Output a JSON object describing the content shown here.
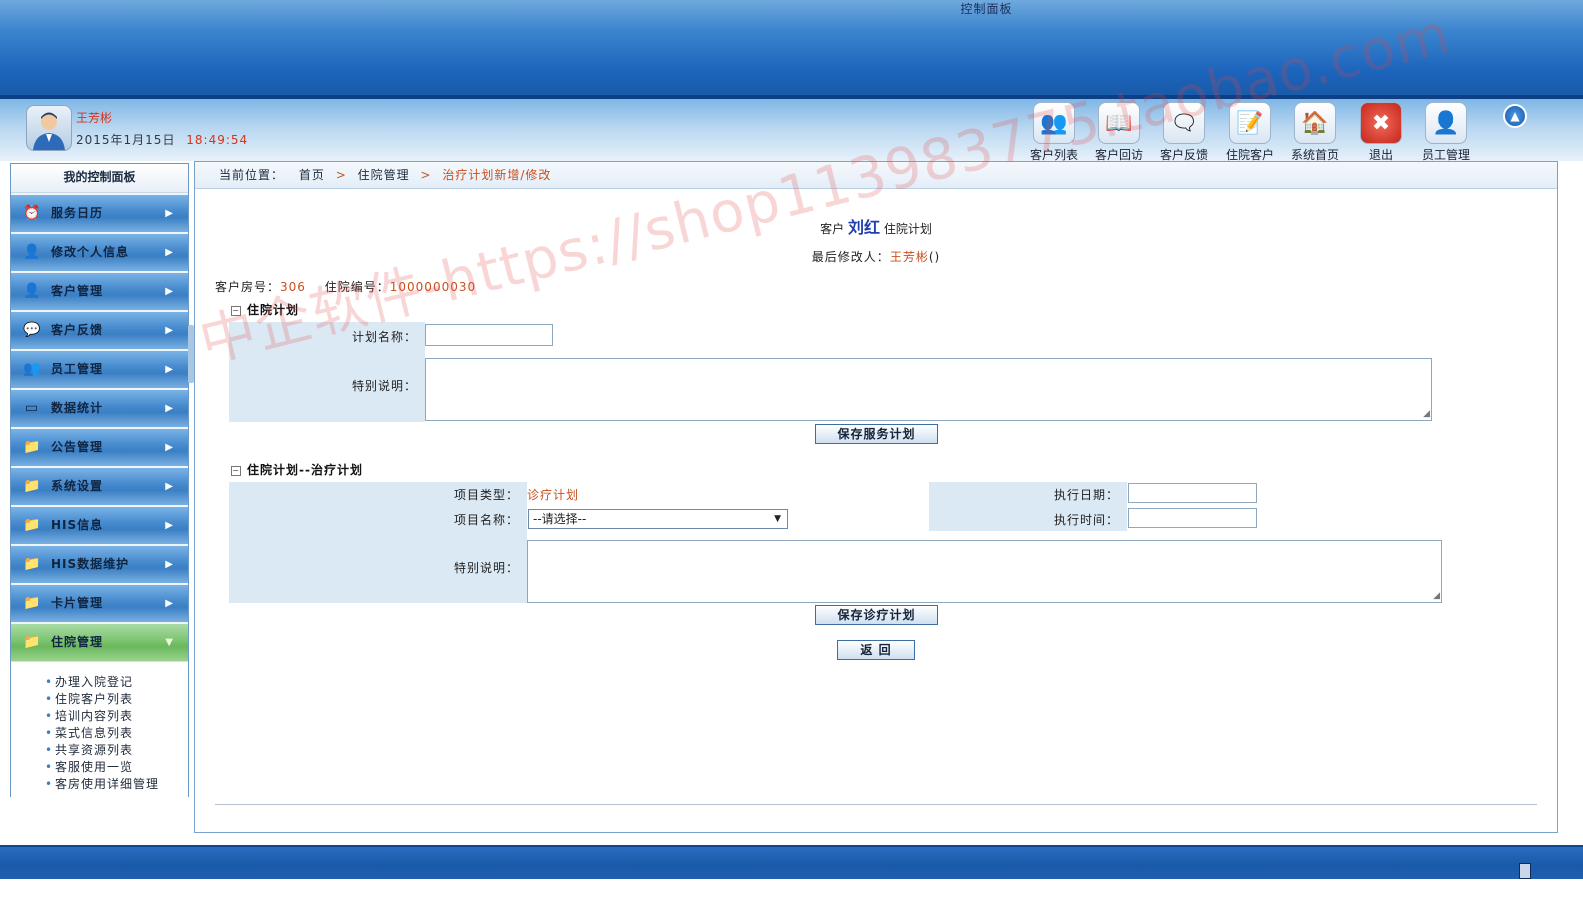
{
  "header": {
    "title": "控制面板"
  },
  "user": {
    "name": "王芳彬",
    "date": "2015年1月15日",
    "time": "18:49:54"
  },
  "toolbar": [
    {
      "label": "客户列表",
      "icon": "👥"
    },
    {
      "label": "客户回访",
      "icon": "📖"
    },
    {
      "label": "客户反馈",
      "icon": "🗨"
    },
    {
      "label": "住院客户",
      "icon": "📝"
    },
    {
      "label": "系统首页",
      "icon": "🏠"
    },
    {
      "label": "退出",
      "icon": "✖"
    },
    {
      "label": "员工管理",
      "icon": "👤"
    }
  ],
  "sidebar": {
    "title": "我的控制面板",
    "items": [
      {
        "label": "服务日历",
        "icon": "⏰"
      },
      {
        "label": "修改个人信息",
        "icon": "👤"
      },
      {
        "label": "客户管理",
        "icon": "👤"
      },
      {
        "label": "客户反馈",
        "icon": "💬"
      },
      {
        "label": "员工管理",
        "icon": "👥"
      },
      {
        "label": "数据统计",
        "icon": "▭"
      },
      {
        "label": "公告管理",
        "icon": "📁"
      },
      {
        "label": "系统设置",
        "icon": "📁"
      },
      {
        "label": "HIS信息",
        "icon": "📁"
      },
      {
        "label": "HIS数据维护",
        "icon": "📁"
      },
      {
        "label": "卡片管理",
        "icon": "📁"
      },
      {
        "label": "住院管理",
        "icon": "📁"
      }
    ],
    "submenu": [
      "办理入院登记",
      "住院客户列表",
      "培训内容列表",
      "菜式信息列表",
      "共享资源列表",
      "客服使用一览",
      "客房使用详细管理"
    ]
  },
  "breadcrumb": {
    "prefix": "当前位置：",
    "home": "首页",
    "level1": "住院管理",
    "current": "治疗计划新增/修改"
  },
  "page": {
    "title_pre": "客户",
    "customer": "刘红",
    "title_post": "住院计划",
    "modifier_label": "最后修改人：",
    "modifier": "王芳彬",
    "modifier_suffix": "()",
    "room_label": "客户房号：",
    "room": "306",
    "adm_label": "住院编号：",
    "adm_no": "1000000030"
  },
  "section1": {
    "title": "住院计划",
    "plan_name_label": "计划名称：",
    "plan_name_value": "",
    "note_label": "特别说明：",
    "note_value": "",
    "save_label": "保存服务计划"
  },
  "section2": {
    "title": "住院计划--治疗计划",
    "type_label": "项目类型：",
    "type_value": "诊疗计划",
    "name_label": "项目名称：",
    "name_selected": "--请选择--",
    "date_label": "执行日期：",
    "date_value": "",
    "time_label": "执行时间：",
    "time_value": "",
    "note_label": "特别说明：",
    "note_value": "",
    "save_label": "保存诊疗计划"
  },
  "back_label": "返 回",
  "watermark": "中企软件-https://shop113983775.taobao.com"
}
